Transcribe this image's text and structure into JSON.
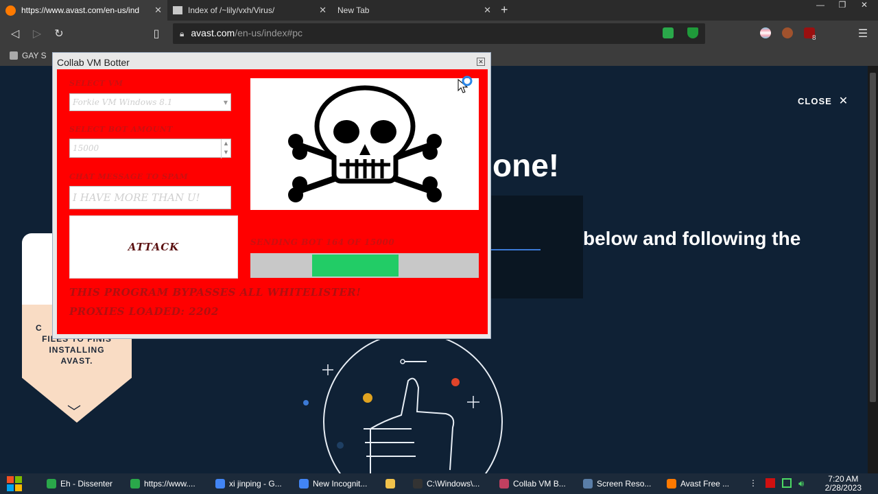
{
  "browser": {
    "tabs": [
      {
        "title": "https://www.avast.com/en-us/ind",
        "active": true
      },
      {
        "title": "Index of /~lily/vxh/Virus/",
        "active": false
      },
      {
        "title": "New Tab",
        "active": false
      }
    ],
    "new_tab_glyph": "+",
    "url_host": "avast.com",
    "url_path": "/en-us/index#pc",
    "bookmark_label": "GAY S",
    "extension_badge": "8"
  },
  "page": {
    "close_label": "CLOSE",
    "headline_tail": "one!",
    "subtext": "below and following the",
    "side_card_text_1": "C",
    "side_card_text_2": "FILES TO FINIS",
    "side_card_text_3": "INSTALLING",
    "side_card_text_4": "AVAST."
  },
  "popup": {
    "title": "Collab VM Botter",
    "select_vm_label": "SELECT VM",
    "select_vm_value": "Forkie VM Windows 8.1",
    "bot_amount_label": "SELECT BOT AMOUNT",
    "bot_amount_value": "15000",
    "chat_label": "CHAT MESSAGE TO SPAM",
    "chat_value": "I HAVE MORE THAN U!",
    "attack_label": "ATTACK",
    "sending_status": "SENDING BOT 164 OF 15000",
    "progress": {
      "fill_start_fraction": 0.27,
      "fill_end_fraction": 0.65
    },
    "bypass_text": "THIS PROGRAM BYPASSES ALL WHITELISTER!",
    "proxies_text": "PROXIES LOADED: 2202"
  },
  "taskbar": {
    "items": [
      {
        "label": "Eh - Dissenter",
        "color": "#2aa84a"
      },
      {
        "label": "https://www....",
        "color": "#2aa84a"
      },
      {
        "label": "xi jinping - G...",
        "color": "#4285f4"
      },
      {
        "label": "New Incognit...",
        "color": "#4285f4"
      },
      {
        "label": "",
        "color": "#f1c24b"
      },
      {
        "label": "C:\\Windows\\...",
        "color": "#333333"
      },
      {
        "label": "Collab VM B...",
        "color": "#c04060"
      },
      {
        "label": "Screen Reso...",
        "color": "#5a7ea8"
      },
      {
        "label": "Avast Free ...",
        "color": "#ff7a00"
      }
    ],
    "time": "7:20 AM",
    "date": "2/28/2023"
  },
  "colors": {
    "popup_bg": "#ff0000",
    "progress_fill": "#22cc66",
    "page_bg": "#0f2135"
  }
}
